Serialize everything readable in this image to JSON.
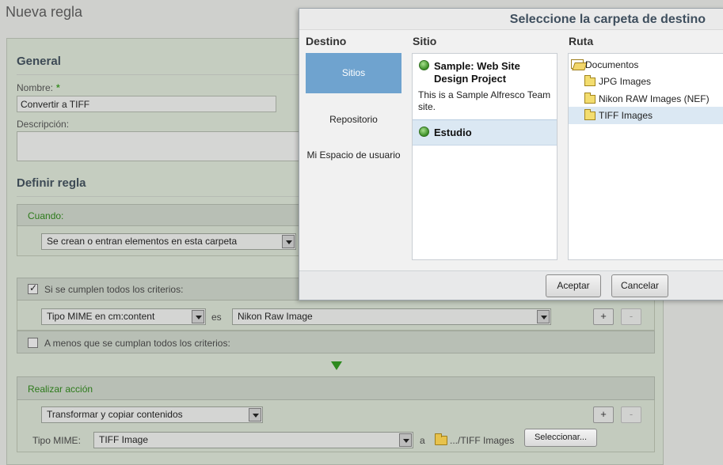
{
  "page": {
    "title": "Nueva regla",
    "general_heading": "General",
    "name_label": "Nombre:",
    "required_mark": "*",
    "name_value": "Convertir a TIFF",
    "description_label": "Descripción:",
    "description_value": "",
    "define_heading": "Definir regla",
    "when_label": "Cuando:",
    "when_value": "Se crean o entran elementos en esta carpeta",
    "all_criteria_label": "Si se cumplen todos los criterios:",
    "all_criteria_checked": true,
    "criteria_field": "Tipo MIME en cm:content",
    "criteria_op": "es",
    "criteria_value": "Nikon Raw Image",
    "add_label": "+",
    "remove_label": "-",
    "unless_label": "A menos que se cumplan todos los criterios:",
    "unless_checked": false,
    "action_label": "Realizar acción",
    "action_value": "Transformar y copiar contenidos",
    "mime_label": "Tipo MIME:",
    "mime_value": "TIFF Image",
    "to_label": "a",
    "dest_path": ".../TIFF Images",
    "select_button": "Seleccionar..."
  },
  "dialog": {
    "title": "Seleccione la carpeta de destino",
    "col_destination": "Destino",
    "col_site": "Sitio",
    "col_path": "Ruta",
    "destinations": [
      {
        "label": "Sitios",
        "selected": true
      },
      {
        "label": "Repositorio",
        "selected": false
      },
      {
        "label": "Mi Espacio de usuario",
        "selected": false
      }
    ],
    "sites": [
      {
        "title": "Sample: Web Site Design Project",
        "desc": "This is a Sample Alfresco Team site.",
        "selected": false
      },
      {
        "title": "Estudio",
        "desc": "",
        "selected": true
      }
    ],
    "tree": [
      {
        "label": "Documentos",
        "level": 0,
        "open": true,
        "selected": false
      },
      {
        "label": "JPG Images",
        "level": 1,
        "open": false,
        "selected": false
      },
      {
        "label": "Nikon RAW Images (NEF)",
        "level": 1,
        "open": false,
        "selected": false
      },
      {
        "label": "TIFF Images",
        "level": 1,
        "open": false,
        "selected": true
      }
    ],
    "ok_button": "Aceptar",
    "cancel_button": "Cancelar"
  }
}
